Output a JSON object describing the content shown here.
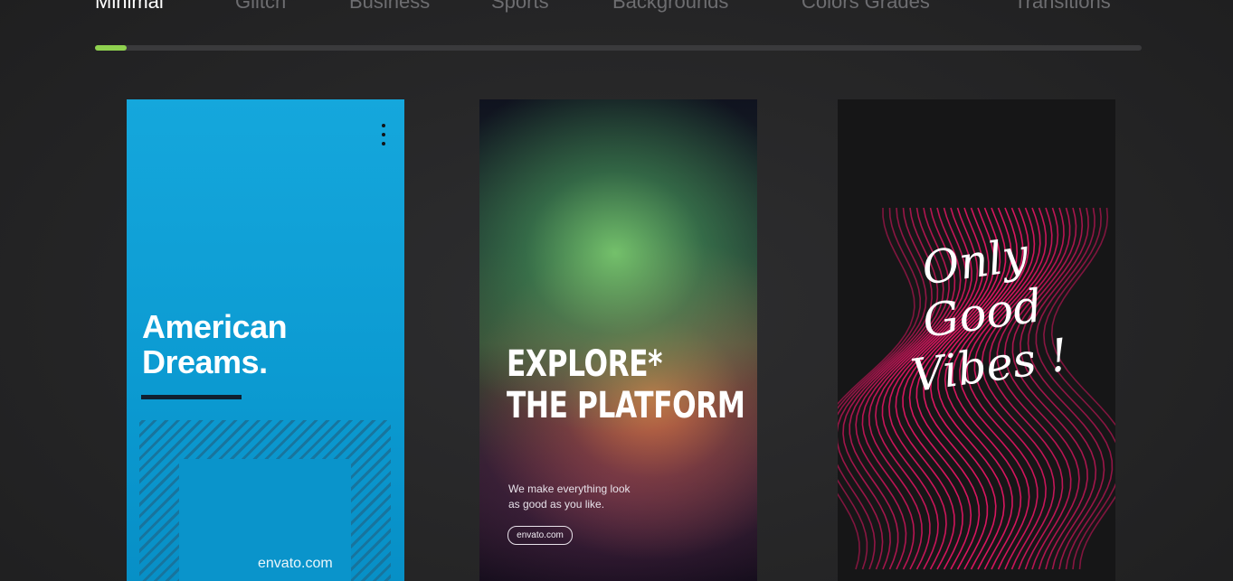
{
  "tabs": [
    "Minimal",
    "Glitch",
    "Business",
    "Sports",
    "Backgrounds",
    "Colors Grades",
    "Transitions"
  ],
  "active_tab": "Minimal",
  "scroll_progress": 0.03,
  "colors": {
    "accent": "#8fd14f",
    "card1_bg": "#0c9bd2",
    "card3_wave": "#d8165f"
  },
  "cards": [
    {
      "title_line1": "American",
      "title_line2": "Dreams.",
      "footer": "envato.com",
      "menu_icon": "kebab-menu-icon"
    },
    {
      "title_line1": "EXPLORE*",
      "title_line2": "THE PLATFORM",
      "subtitle_line1": "We make everything look",
      "subtitle_line2": "as good as you like.",
      "button_label": "envato.com"
    },
    {
      "script_line1": "Only",
      "script_line2": "Good",
      "script_line3": "Vibes !"
    }
  ]
}
